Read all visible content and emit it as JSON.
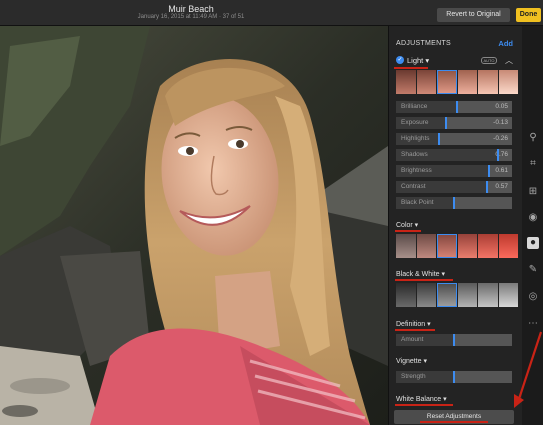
{
  "titlebar": {
    "title": "Muir Beach",
    "meta": "January 16, 2015 at 11:49 AM · 37 of 51",
    "revert_label": "Revert to Original",
    "done_label": "Done"
  },
  "adjustments": {
    "header": "ADJUSTMENTS",
    "add_label": "Add",
    "light": {
      "label": "Light",
      "auto_label": "AUTO",
      "sliders": [
        {
          "label": "Brilliance",
          "value": "0.05",
          "level": 0.525
        },
        {
          "label": "Exposure",
          "value": "-0.13",
          "level": 0.435
        },
        {
          "label": "Highlights",
          "value": "-0.26",
          "level": 0.37
        },
        {
          "label": "Shadows",
          "value": "0.76",
          "level": 0.88
        },
        {
          "label": "Brightness",
          "value": "0.61",
          "level": 0.805
        },
        {
          "label": "Contrast",
          "value": "0.57",
          "level": 0.785
        },
        {
          "label": "Black Point",
          "value": "",
          "level": 0.5
        }
      ]
    },
    "color": {
      "label": "Color"
    },
    "black_white": {
      "label": "Black & White"
    },
    "definition": {
      "label": "Definition",
      "slider_label": "Amount",
      "level": 0.5
    },
    "vignette": {
      "label": "Vignette",
      "slider_label": "Strength",
      "level": 0.5
    },
    "white_balance": {
      "label": "White Balance"
    },
    "reset_label": "Reset Adjustments"
  },
  "tools": [
    "magic-wand-icon",
    "crop-rotate-icon",
    "straighten-icon",
    "filters-icon",
    "adjust-icon",
    "retouch-icon",
    "red-eye-icon",
    "more-icon"
  ],
  "colors": {
    "accent": "#3d8cf0",
    "done": "#f0c020",
    "annotation": "#c92316"
  }
}
